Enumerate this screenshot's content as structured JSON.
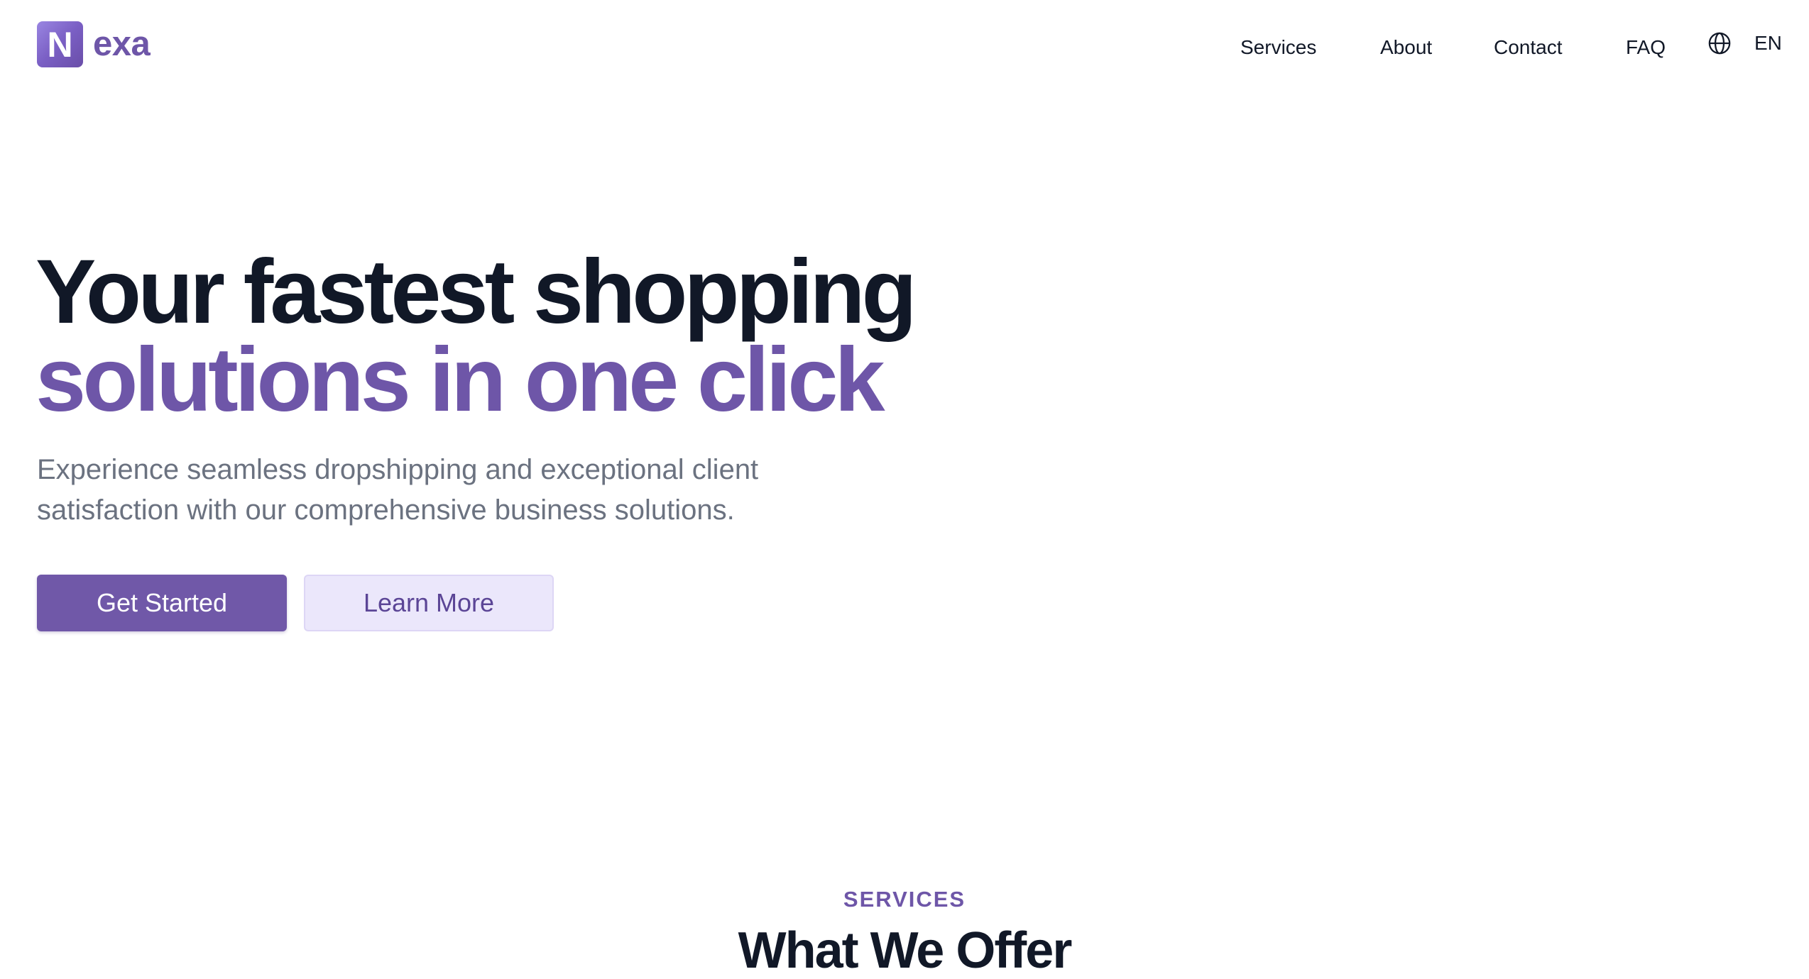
{
  "brand": {
    "mark_letter": "N",
    "name": "exa"
  },
  "nav": {
    "items": [
      {
        "label": "Services"
      },
      {
        "label": "About"
      },
      {
        "label": "Contact"
      },
      {
        "label": "FAQ"
      }
    ],
    "language": {
      "icon": "globe-icon",
      "label": "EN"
    }
  },
  "hero": {
    "title_line1": "Your fastest shopping",
    "title_line2": "solutions in one click",
    "subtitle": "Experience seamless dropshipping and exceptional client satisfaction with our comprehensive business solutions.",
    "primary_button": "Get Started",
    "secondary_button": "Learn More"
  },
  "services_section": {
    "eyebrow": "SERVICES",
    "title": "What We Offer"
  },
  "colors": {
    "brand_purple": "#6e56a8",
    "primary_button": "#7058a8",
    "secondary_button_bg": "#ebe7fb",
    "heading_dark": "#111827",
    "body_gray": "#6b7280"
  }
}
